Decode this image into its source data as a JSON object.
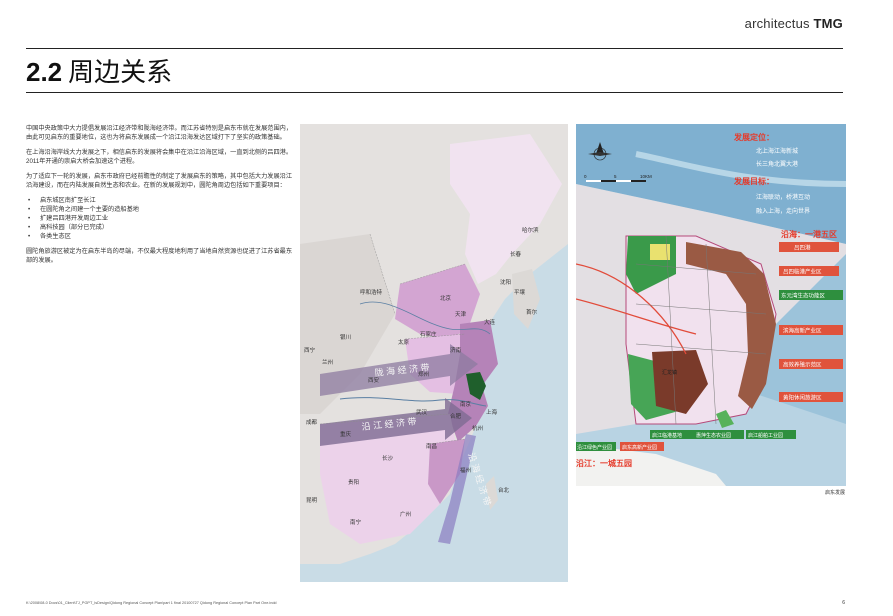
{
  "header": {
    "brand_regular": "architectus",
    "brand_bold": "TMG"
  },
  "title": {
    "number": "2.2",
    "text": "周边关系"
  },
  "body": {
    "para1": "中国中央政策中大力提倡发展沿江经济带和陇海经济带。而江苏省特别是启东市就在发展范围内，由此可见启东的重要地位，这也为将启东发展成一个沿江沿海发达区域打下了坚实的政策基础。",
    "para2": "在上海沿海岸线大力发展之下，相信启东的发展将会集中在沿江沿海区域，一直到北侧的吕四港。2011年开通的崇启大桥会加速这个进程。",
    "para3": "为了适应下一轮的发展，启东市政府已经前瞻性的制定了发展启东的策略，其中包括大力发展沿江沿海建设，而在内陆发展自然生态和农业。在新的发展规划中，圆陀角周边包括如下重要项目：",
    "bullets": [
      "启东城区南扩至长江",
      "在圆陀角之间建一个主要的造船基地",
      "扩建吕四港开发周边工业",
      "高科技园（部分已完成）",
      "各类生态区"
    ],
    "para4": "圆陀角旅游区被定为在启东半岛的尽端，不仅最大程度地利用了当地自然资源也促进了江苏省最东部的发展。"
  },
  "left_map": {
    "cities": [
      "哈尔滨",
      "长春",
      "沈阳",
      "呼和浩特",
      "北京",
      "天津",
      "大连",
      "石家庄",
      "济南",
      "太原",
      "银川",
      "兰州",
      "西宁",
      "西安",
      "郑州",
      "南京",
      "上海",
      "合肥",
      "武汉",
      "成都",
      "重庆",
      "长沙",
      "南昌",
      "杭州",
      "福州",
      "贵阳",
      "昆明",
      "南宁",
      "广州",
      "台北",
      "平壤",
      "首尔"
    ],
    "corridor_upper": "陇 海 经 济 带",
    "corridor_lower": "沿 江 经 济 带",
    "coast_label": "沿 海 经 济 带"
  },
  "right_map": {
    "positioning_title": "发展定位：",
    "positioning_1": "北上海江海新城",
    "positioning_2": "长三角北翼大港",
    "goal_title": "发展目标：",
    "goal_1": "江海联动，桥港互动",
    "goal_2": "融入上海，走向世界",
    "coast_title": "沿海：一港五区",
    "coast_items": [
      "吕四港",
      "吕四临港产业区",
      "东元湾生态功能区",
      "滨海高新产业区",
      "高效养殖示范区",
      "黄阳休闲旅游区"
    ],
    "river_items": [
      "沿江绿色产业园",
      "启东高新产业园",
      "启江临港基地",
      "惠萍生态农业园",
      "启江船舶工业园"
    ],
    "river_title": "沿江：一城五园",
    "city_label": "汇龙镇",
    "scale_label": "10KM",
    "scale_zero": "0",
    "scale_five": "5"
  },
  "caption": "启东发展",
  "footer": {
    "path": "K:\\2008\\08-0 Docs\\01_Client\\TJ_PGPT_lsDesign\\Qidong Regional Concept Plan\\part 1 final 20100727 Qidong Regional Concept Plan Part One.indd",
    "page": "6"
  },
  "colors": {
    "sea": "#c7dde8",
    "land": "#e6e3e0",
    "province_focus": "#d9a6d8",
    "province_light": "#efd8ee",
    "river_blue": "#3d8fc4",
    "red_label": "#d8392c",
    "green": "#2c8c3b",
    "brown": "#8b4a36"
  }
}
